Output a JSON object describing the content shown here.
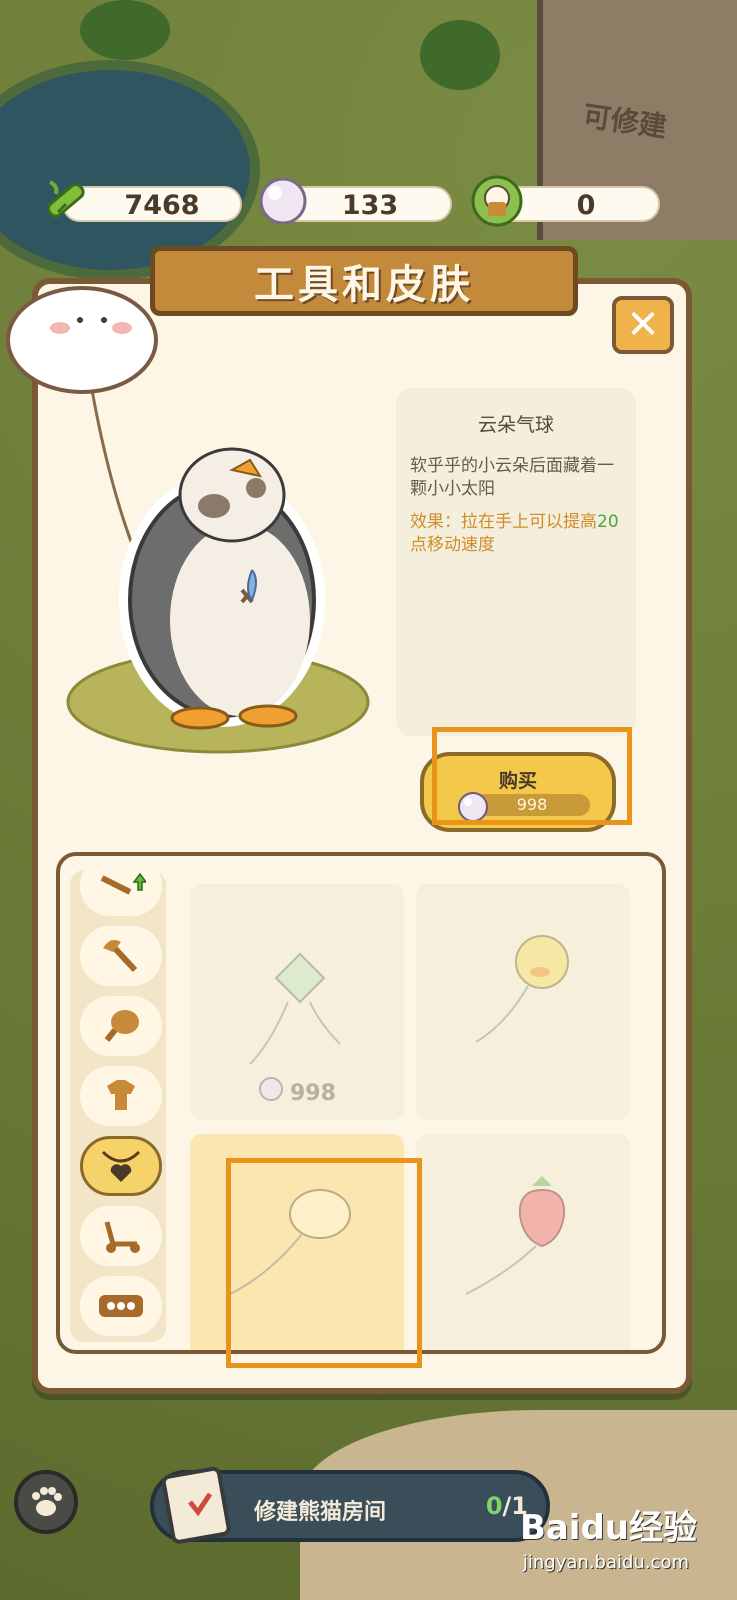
{
  "resources": {
    "bamboo": "7468",
    "pearl": "133",
    "panda_coin": "0"
  },
  "panel": {
    "title": "工具和皮肤",
    "close_label": "✕"
  },
  "background": {
    "building_label": "可修建"
  },
  "item_detail": {
    "name": "云朵气球",
    "description": "软乎乎的小云朵后面藏着一颗小小太阳",
    "effect_prefix": "效果：拉在手上可以提高",
    "effect_value": "20",
    "effect_suffix": "点移动速度"
  },
  "buy_button": {
    "label": "购买",
    "price": "998"
  },
  "categories": [
    {
      "icon": "sword-upgrade-icon"
    },
    {
      "icon": "axe-icon"
    },
    {
      "icon": "drumstick-icon"
    },
    {
      "icon": "clothes-icon"
    },
    {
      "icon": "heart-necklace-icon",
      "active": true
    },
    {
      "icon": "scooter-icon"
    },
    {
      "icon": "more-icon"
    }
  ],
  "items": [
    {
      "icon": "kite-icon",
      "price": "998"
    },
    {
      "icon": "duck-balloon-icon",
      "price": ""
    },
    {
      "icon": "cloud-balloon-icon",
      "price": "",
      "selected": true
    },
    {
      "icon": "strawberry-balloon-icon",
      "price": ""
    }
  ],
  "quest": {
    "text": "修建熊猫房间",
    "done": "0",
    "total": "/1"
  },
  "watermark": {
    "brand": "Baidu经验",
    "url": "jingyan.baidu.com"
  },
  "colors": {
    "panel_border": "#7a5a34",
    "panel_bg": "#fdf6e6",
    "accent_orange": "#e8931a",
    "buy_yellow": "#f4c94a",
    "effect_green": "#4aa63a",
    "effect_orange": "#d08c2a"
  }
}
